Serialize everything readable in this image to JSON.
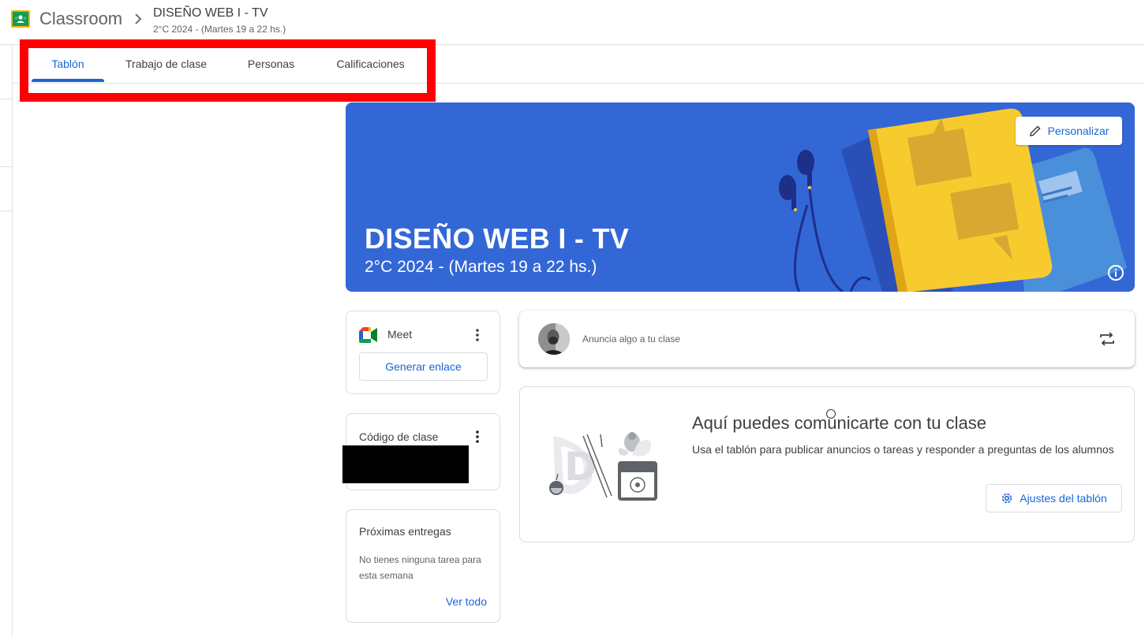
{
  "header": {
    "app_name": "Classroom",
    "class_name": "DISEÑO WEB I - TV",
    "class_section": "2°C 2024 - (Martes 19 a 22 hs.)"
  },
  "tabs": [
    {
      "label": "Tablón",
      "active": true
    },
    {
      "label": "Trabajo de clase",
      "active": false
    },
    {
      "label": "Personas",
      "active": false
    },
    {
      "label": "Calificaciones",
      "active": false
    }
  ],
  "banner": {
    "title": "DISEÑO WEB I - TV",
    "subtitle": "2°C 2024 - (Martes 19 a 22 hs.)",
    "customize_label": "Personalizar",
    "background_color": "#3367d6"
  },
  "meet": {
    "label": "Meet",
    "generate_link_label": "Generar enlace"
  },
  "class_code": {
    "label": "Código de clase"
  },
  "upcoming": {
    "title": "Próximas entregas",
    "empty_message": "No tienes ninguna tarea para esta semana",
    "view_all_label": "Ver todo"
  },
  "announce": {
    "placeholder": "Anuncia algo a tu clase"
  },
  "stream_empty": {
    "title": "Aquí puedes comunicarte con tu clase",
    "description": "Usa el tablón para publicar anuncios o tareas y responder a preguntas de los alumnos",
    "settings_label": "Ajustes del tablón"
  },
  "colors": {
    "accent": "#1967d2",
    "highlight_box": "#ff0000",
    "logo_green": "#0f9d58",
    "logo_yellow": "#f4b400"
  }
}
